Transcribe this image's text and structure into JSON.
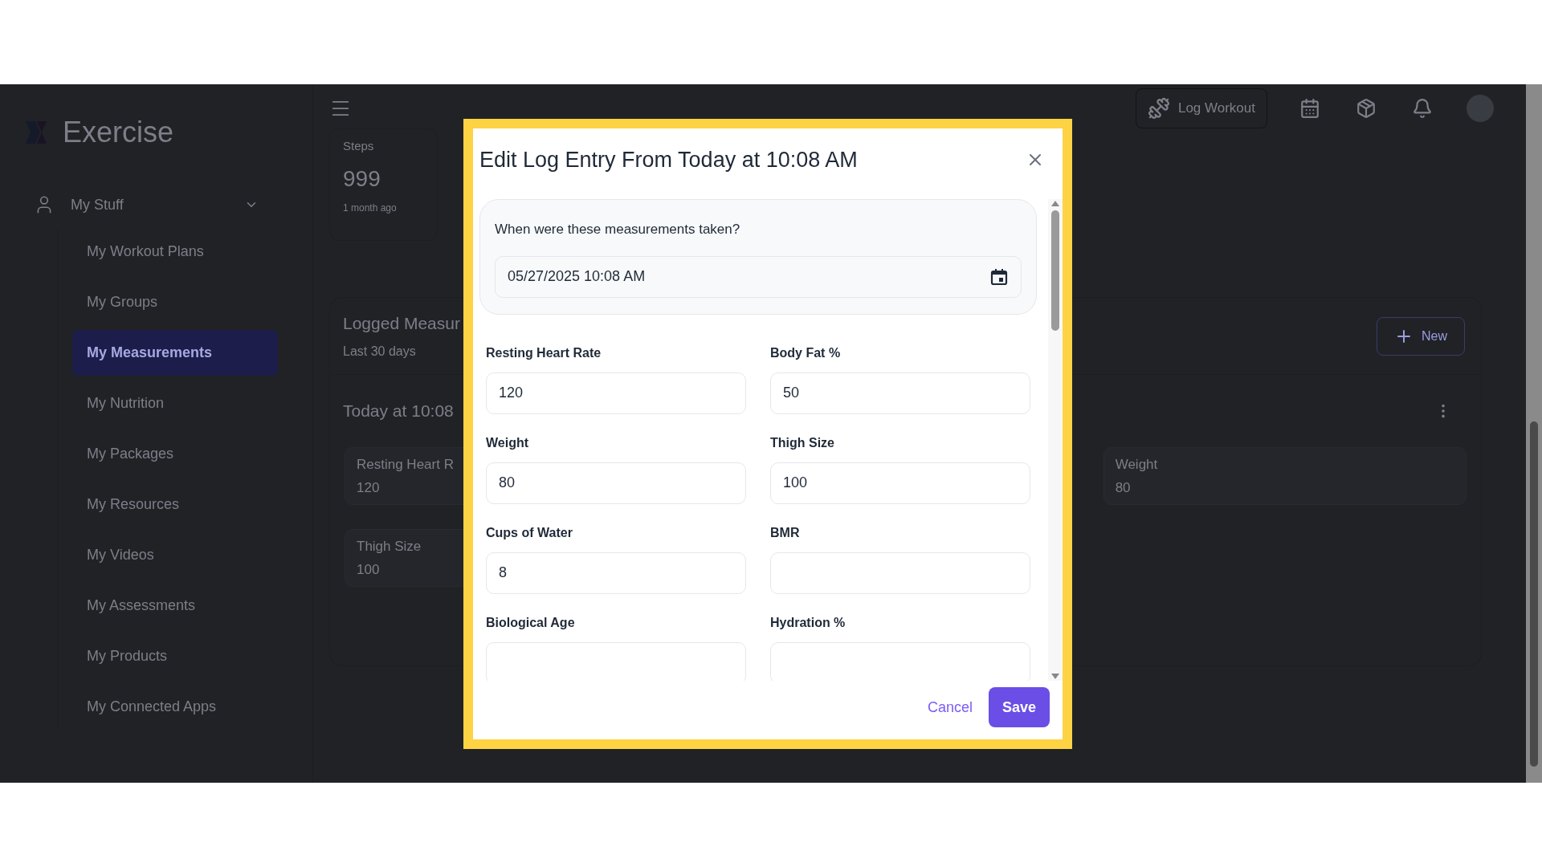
{
  "app": {
    "logo": "Exercise"
  },
  "sidebar": {
    "group": {
      "label": "My Stuff",
      "expanded": true
    },
    "items": [
      {
        "label": "My Workout Plans",
        "selected": false
      },
      {
        "label": "My Groups",
        "selected": false
      },
      {
        "label": "My Measurements",
        "selected": true
      },
      {
        "label": "My Nutrition",
        "selected": false
      },
      {
        "label": "My Packages",
        "selected": false
      },
      {
        "label": "My Resources",
        "selected": false
      },
      {
        "label": "My Videos",
        "selected": false
      },
      {
        "label": "My Assessments",
        "selected": false
      },
      {
        "label": "My Products",
        "selected": false
      },
      {
        "label": "My Connected Apps",
        "selected": false
      }
    ]
  },
  "header": {
    "log_workout": "Log Workout"
  },
  "steps_card": {
    "label": "Steps",
    "value": "999",
    "time": "1 month ago"
  },
  "measurements": {
    "title": "Logged Measur",
    "subtitle": "Last 30 days",
    "new_button": "New",
    "entry_title": "Today at 10:08",
    "tiles": [
      {
        "label": "Resting Heart R",
        "value": "120"
      },
      {
        "label": "Weight",
        "value": "80"
      },
      {
        "label": "Thigh Size",
        "value": "100"
      }
    ]
  },
  "dialog": {
    "title": "Edit Log Entry From Today at 10:08 AM",
    "date_question": "When were these measurements taken?",
    "date_value": "05/27/2025 10:08 AM",
    "fields": [
      {
        "label": "Resting Heart Rate",
        "value": "120"
      },
      {
        "label": "Body Fat %",
        "value": "50"
      },
      {
        "label": "Weight",
        "value": "80"
      },
      {
        "label": "Thigh Size",
        "value": "100"
      },
      {
        "label": "Cups of Water",
        "value": "8"
      },
      {
        "label": "BMR"
      },
      {
        "label": "Biological Age"
      },
      {
        "label": "Hydration %"
      }
    ],
    "cancel": "Cancel",
    "save": "Save"
  }
}
